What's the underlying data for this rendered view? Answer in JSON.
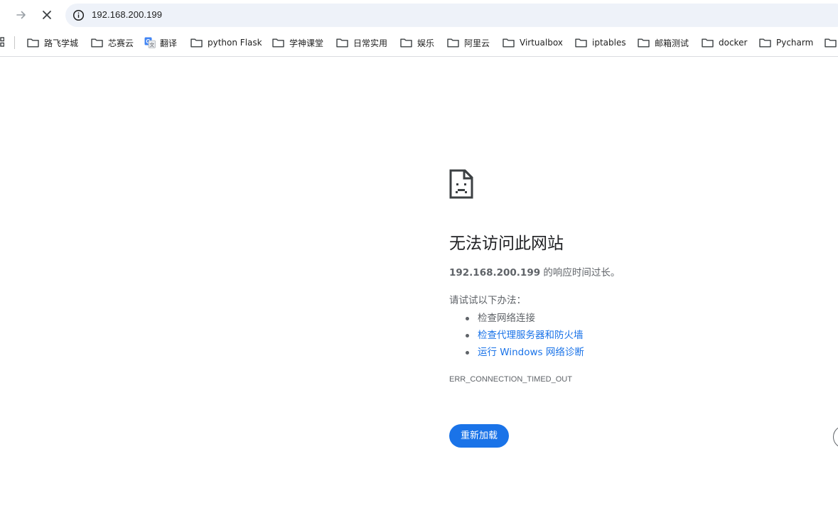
{
  "toolbar": {
    "url": "192.168.200.199",
    "icons": {
      "forward": "arrow-right-icon",
      "stop": "close-icon",
      "site_info": "info-icon"
    }
  },
  "bookmarks": [
    {
      "label": "路飞学城",
      "icon": "folder-icon"
    },
    {
      "label": "芯赛云",
      "icon": "folder-icon"
    },
    {
      "label": "翻译",
      "icon": "google-translate-icon"
    },
    {
      "label": "python Flask",
      "icon": "folder-icon"
    },
    {
      "label": "学神课堂",
      "icon": "folder-icon"
    },
    {
      "label": "日常实用",
      "icon": "folder-icon"
    },
    {
      "label": "娱乐",
      "icon": "folder-icon"
    },
    {
      "label": "阿里云",
      "icon": "folder-icon"
    },
    {
      "label": "Virtualbox",
      "icon": "folder-icon"
    },
    {
      "label": "iptables",
      "icon": "folder-icon"
    },
    {
      "label": "邮箱测试",
      "icon": "folder-icon"
    },
    {
      "label": "docker",
      "icon": "folder-icon"
    },
    {
      "label": "Pycharm",
      "icon": "folder-icon"
    }
  ],
  "error_page": {
    "heading": "无法访问此网站",
    "host": "192.168.200.199",
    "message_suffix": " 的响应时间过长。",
    "try_label": "请试试以下办法：",
    "suggestions": [
      {
        "text": "检查网络连接",
        "link": false
      },
      {
        "text": "检查代理服务器和防火墙",
        "link": true
      },
      {
        "text": "运行 Windows 网络诊断",
        "link": true
      }
    ],
    "error_code": "ERR_CONNECTION_TIMED_OUT",
    "reload_label": "重新加载"
  },
  "colors": {
    "accent": "#1a73e8",
    "omnibox_bg": "#eef2f9",
    "secondary_text": "#5f6368"
  }
}
